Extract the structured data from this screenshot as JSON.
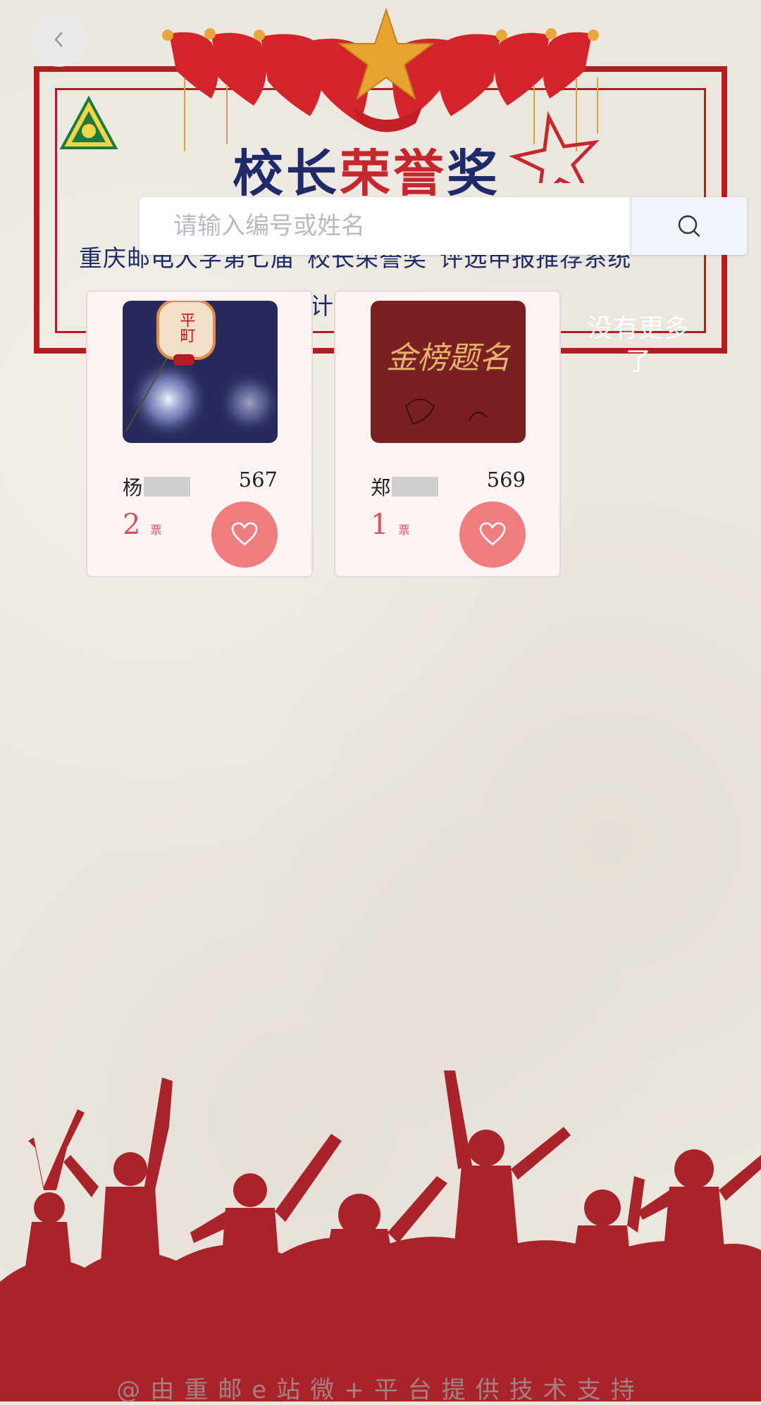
{
  "banner": {
    "title_part1": "校长",
    "title_part2": "荣誉",
    "title_part3": "奖",
    "subtitle": "重庆邮电大学第七届“校长荣誉奖”评选申报推荐系统",
    "subtitle_line2": "计首"
  },
  "search": {
    "placeholder": "请输入编号或姓名"
  },
  "candidates": [
    {
      "surname": "杨",
      "number": "567",
      "votes": "2",
      "vote_unit": "票"
    },
    {
      "surname": "郑",
      "number": "569",
      "votes": "1",
      "vote_unit": "票"
    }
  ],
  "card2_image_text": "金榜题名",
  "card1_image_text": "平町",
  "no_more_text": "没有更多了",
  "footer": "@由重邮e站微+平台提供技术支持",
  "colors": {
    "accent_red": "#b51c22",
    "like_pink": "#f07d7f",
    "vote_red": "#d8505c",
    "title_blue": "#1f2a6b"
  }
}
